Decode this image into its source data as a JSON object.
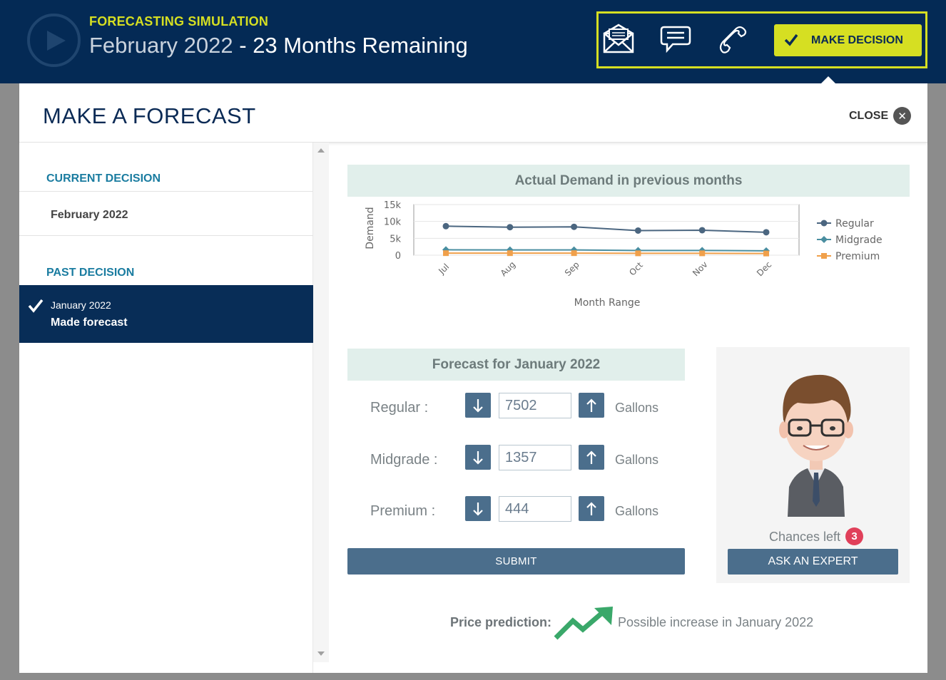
{
  "header": {
    "simulation_label": "FORECASTING SIMULATION",
    "current_month": "February 2022",
    "separator": " - ",
    "months_remaining": "23 Months Remaining",
    "make_decision_label": "MAKE DECISION",
    "icons": [
      "play-icon",
      "email-icon",
      "chat-icon",
      "phone-icon",
      "checkmark-icon"
    ],
    "accent_color": "#d6df22",
    "brand_color": "#042a55"
  },
  "modal": {
    "title": "MAKE A FORECAST",
    "close_label": "CLOSE"
  },
  "sidebar": {
    "current_decision_label": "CURRENT DECISION",
    "current_decision_value": "February  2022",
    "past_decision_label": "PAST DECISION",
    "past_items": [
      {
        "date": "January 2022",
        "status": "Made forecast"
      }
    ]
  },
  "chart": {
    "heading": "Actual Demand in previous months"
  },
  "chart_data": {
    "type": "line",
    "categories": [
      "Jul",
      "Aug",
      "Sep",
      "Oct",
      "Nov",
      "Dec"
    ],
    "series": [
      {
        "name": "Regular",
        "values": [
          8600,
          8300,
          8400,
          7300,
          7400,
          6800
        ],
        "color": "#4b6680",
        "marker": "circle"
      },
      {
        "name": "Midgrade",
        "values": [
          1600,
          1550,
          1550,
          1400,
          1400,
          1300
        ],
        "color": "#4a8ea0",
        "marker": "diamond"
      },
      {
        "name": "Premium",
        "values": [
          600,
          600,
          600,
          550,
          550,
          500
        ],
        "color": "#f0a04b",
        "marker": "square"
      }
    ],
    "xlabel": "Month Range",
    "ylabel": "Demand",
    "yticks": [
      "0",
      "5k",
      "10k",
      "15k"
    ],
    "ylim": [
      0,
      15000
    ],
    "grid": true,
    "legend": "right"
  },
  "forecast": {
    "heading": "Forecast for January 2022",
    "rows": [
      {
        "label": "Regular :",
        "value": "7502",
        "unit": "Gallons"
      },
      {
        "label": "Midgrade :",
        "value": "1357",
        "unit": "Gallons"
      },
      {
        "label": "Premium :",
        "value": "444",
        "unit": "Gallons"
      }
    ],
    "submit_label": "SUBMIT"
  },
  "expert": {
    "chances_label": "Chances left",
    "chances_count": "3",
    "ask_label": "ASK AN EXPERT"
  },
  "price_prediction": {
    "label": "Price prediction",
    "colon": ":",
    "text": "Possible increase in January 2022",
    "trend_color": "#3aa86a"
  }
}
